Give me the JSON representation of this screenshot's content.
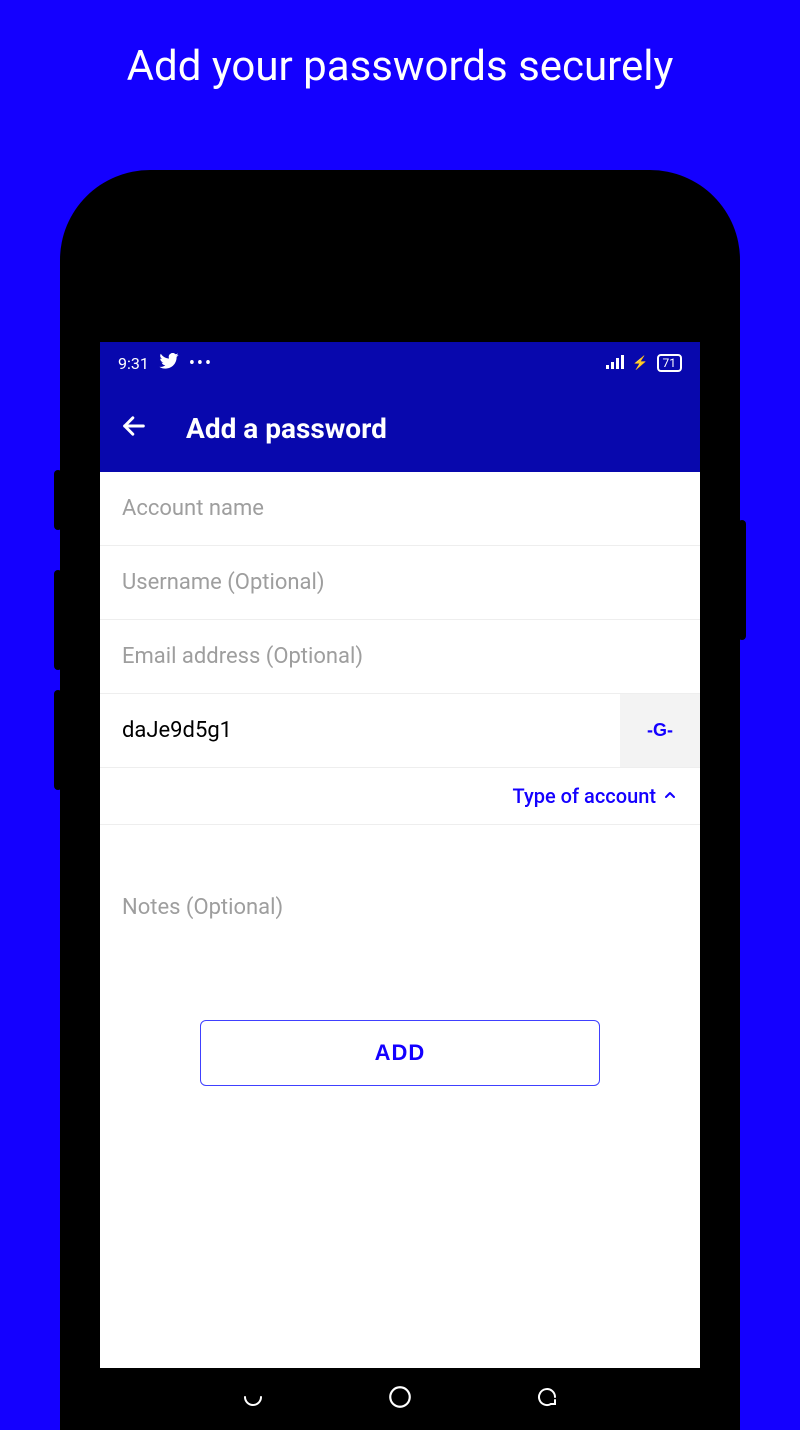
{
  "marketing": {
    "title": "Add your passwords securely"
  },
  "status": {
    "time": "9:31",
    "battery": "71"
  },
  "appbar": {
    "title": "Add a password"
  },
  "form": {
    "account_placeholder": "Account name",
    "username_placeholder": "Username (Optional)",
    "email_placeholder": "Email address (Optional)",
    "password_value": "daJe9d5g1",
    "generate_label": "-G-",
    "type_label": "Type of account",
    "notes_placeholder": "Notes (Optional)",
    "add_label": "ADD"
  }
}
